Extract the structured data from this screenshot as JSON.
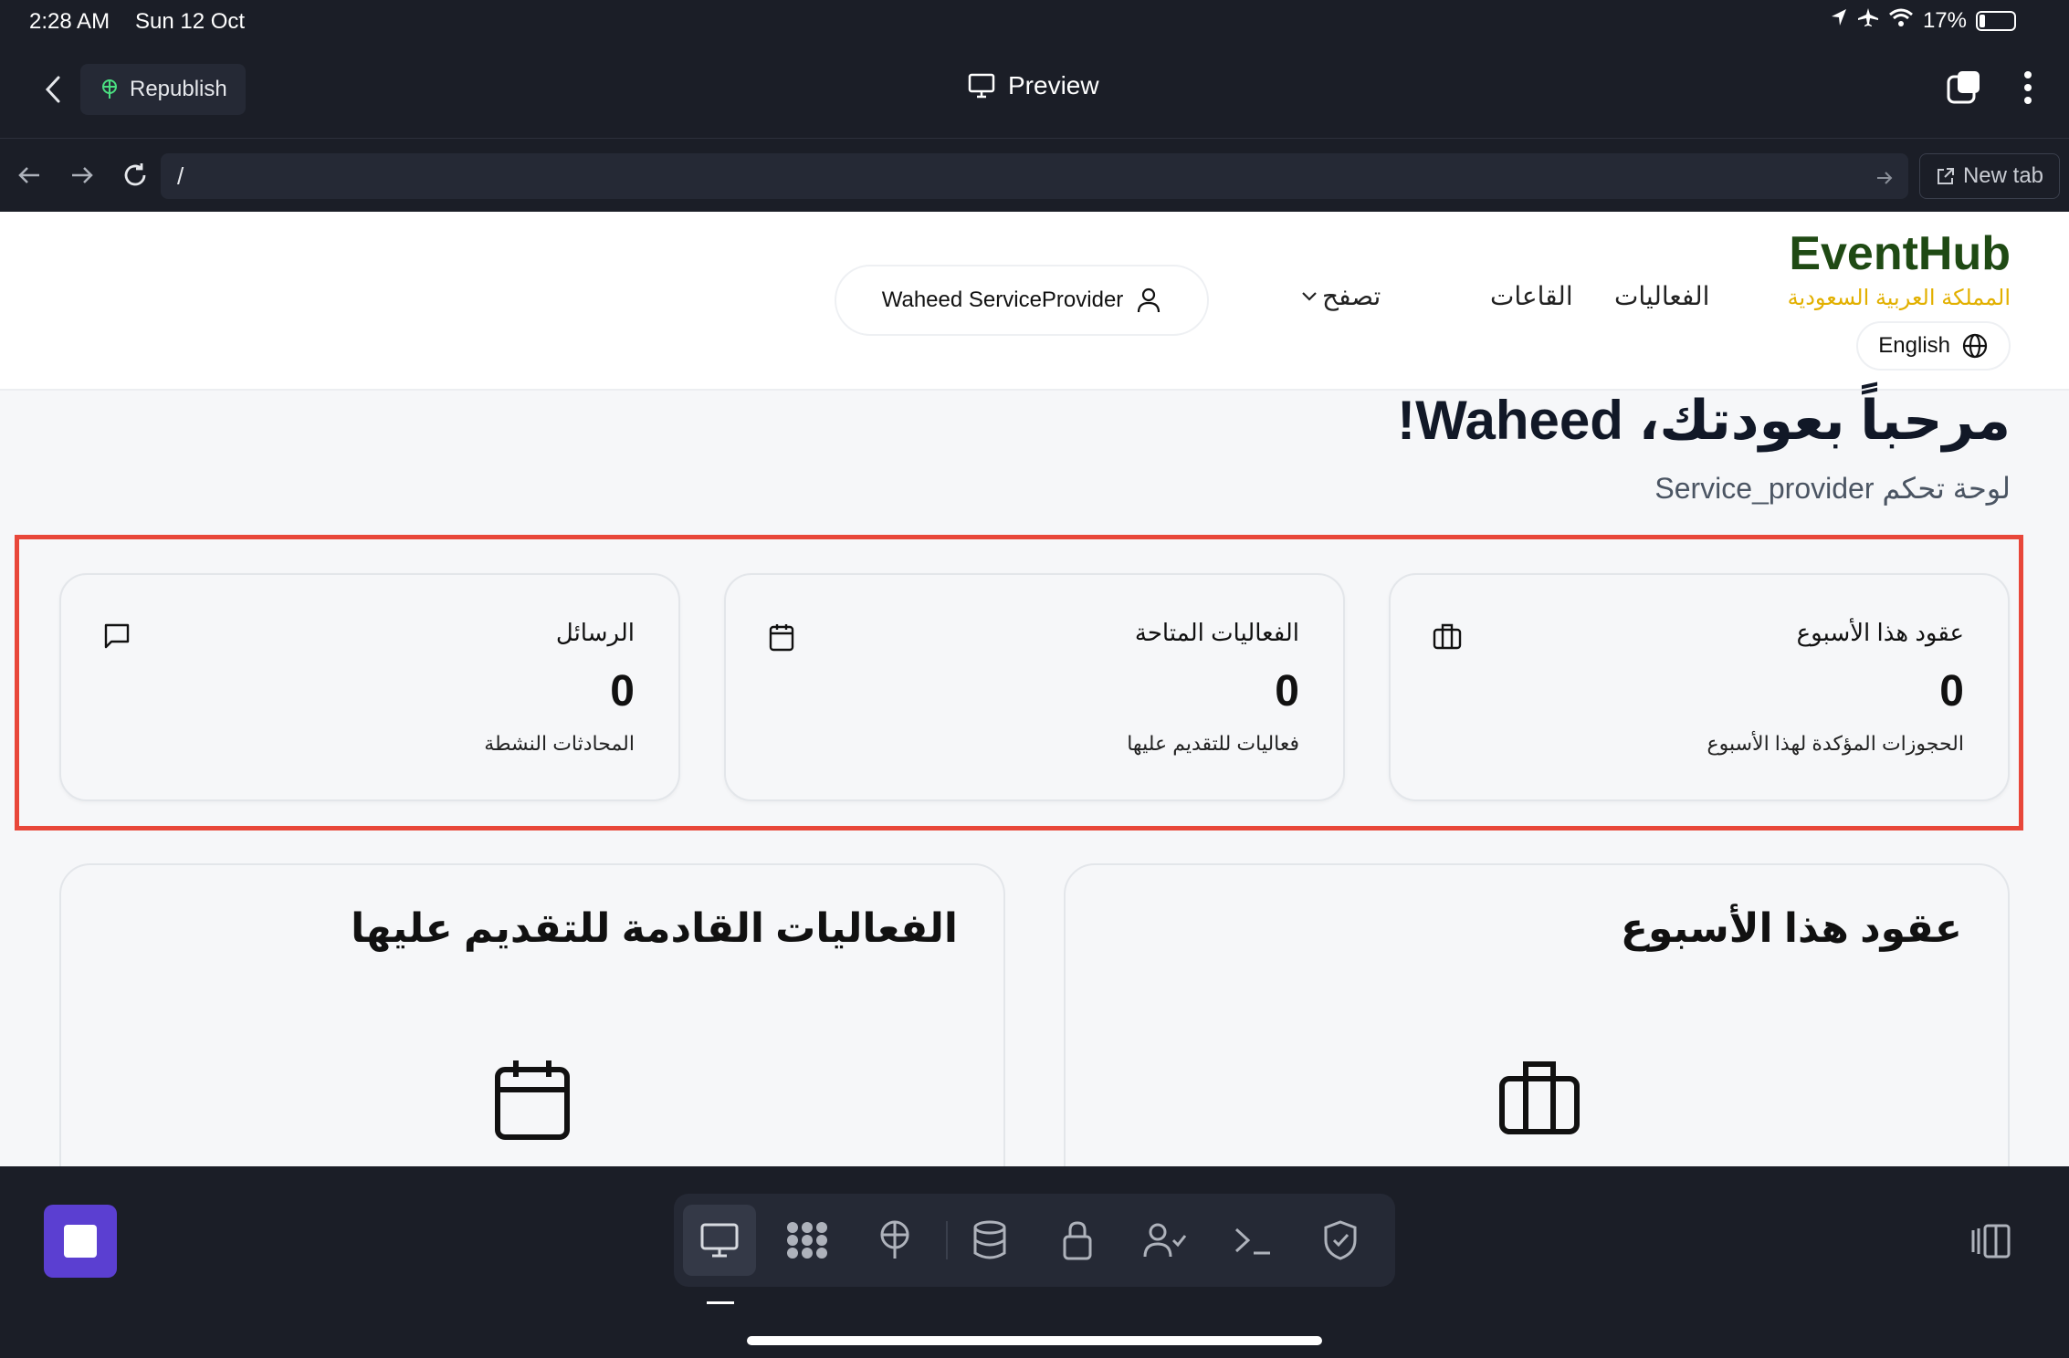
{
  "status_bar": {
    "time": "2:28 AM",
    "date": "Sun 12 Oct",
    "battery": "17%",
    "battery_level": 0.17
  },
  "toolbar": {
    "republish_label": "Republish",
    "preview_label": "Preview"
  },
  "address_bar": {
    "url": "/",
    "new_tab_label": "New tab"
  },
  "site": {
    "brand": "EventHub",
    "region": "المملكة العربية السعودية",
    "language_button": "English",
    "nav": {
      "events": "الفعاليات",
      "venues": "القاعات",
      "browse": "تصفح"
    },
    "user_button": "Waheed ServiceProvider",
    "welcome": "مرحباً بعودتك، Waheed!",
    "subtitle": "لوحة تحكم Service_provider",
    "stats": [
      {
        "title": "عقود هذا الأسبوع",
        "value": "0",
        "desc": "الحجوزات المؤكدة لهذا الأسبوع",
        "icon": "briefcase-icon"
      },
      {
        "title": "الفعاليات المتاحة",
        "value": "0",
        "desc": "فعاليات للتقديم عليها",
        "icon": "calendar-icon"
      },
      {
        "title": "الرسائل",
        "value": "0",
        "desc": "المحادثات النشطة",
        "icon": "message-icon"
      }
    ],
    "sections": {
      "contracts": "عقود هذا الأسبوع",
      "upcoming": "الفعاليات القادمة للتقديم عليها"
    }
  },
  "colors": {
    "brand": "#1f4a14",
    "region": "#e2b000",
    "highlight": "#e8473a",
    "stop": "#5b3fd1"
  }
}
